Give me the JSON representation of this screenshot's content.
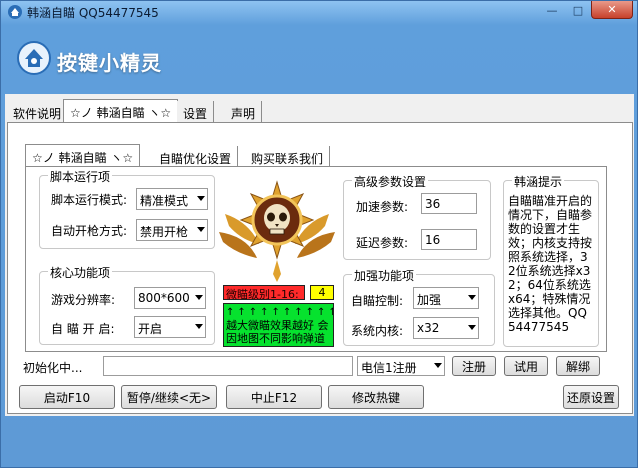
{
  "window": {
    "title": "韩涵自瞄 QQ54477545",
    "min_label": "—",
    "max_label": "□",
    "close_label": "✕"
  },
  "banner": {
    "logo_text": "按键小精灵"
  },
  "main_tabs": [
    {
      "label": "软件说明"
    },
    {
      "label": "☆ノ 韩涵自瞄 ヽ☆"
    },
    {
      "label": "设置"
    },
    {
      "label": "声明"
    }
  ],
  "sub_tabs": [
    {
      "label": "☆ノ 韩涵自瞄 ヽ☆"
    },
    {
      "label": "自瞄优化设置"
    },
    {
      "label": "购买联系我们"
    }
  ],
  "script_group": {
    "title": "脚本运行项",
    "mode_label": "脚本运行模式:",
    "mode_value": "精准模式",
    "fire_label": "自动开枪方式:",
    "fire_value": "禁用开枪"
  },
  "core_group": {
    "title": "核心功能项",
    "resolution_label": "游戏分辨率:",
    "resolution_value": "800*600",
    "aim_label": "自 瞄 开 启:",
    "aim_value": "开启"
  },
  "advanced_group": {
    "title": "高级参数设置",
    "accel_label": "加速参数:",
    "accel_value": "36",
    "delay_label": "延迟参数:",
    "delay_value": "16"
  },
  "enhance_group": {
    "title": "加强功能项",
    "aim_control_label": "自瞄控制:",
    "aim_control_value": "加强",
    "kernel_label": "系统内核:",
    "kernel_value": "x32"
  },
  "hint_group": {
    "title": "韩涵提示",
    "text": "自瞄瞄准开启的情况下，自瞄参数的设置才生效；内核支持按照系统选择，32位系统选择x32；64位系统选x64；特殊情况选择其他。QQ54477545"
  },
  "emblem": {
    "level_label": "微瞄级别1-16:",
    "level_value": "4",
    "warning_arrows": "↑↑↑↑↑↑↑↑↑↑",
    "warning_text": "越大微瞄效果越好 会因地图不同影响弹道"
  },
  "status": {
    "init_label": "初始化中...",
    "server_value": "电信1注册",
    "register_button": "注册",
    "trial_button": "试用",
    "unbind_button": "解绑"
  },
  "bottom_buttons": {
    "start": "启动F10",
    "pause": "暂停/继续<无>",
    "stop": "中止F12",
    "hotkey": "修改热键",
    "restore": "还原设置"
  },
  "colors": {
    "level_bg": "#ff2a2a",
    "level_value_bg": "#ffff00",
    "warning_bg": "#06e22e"
  }
}
